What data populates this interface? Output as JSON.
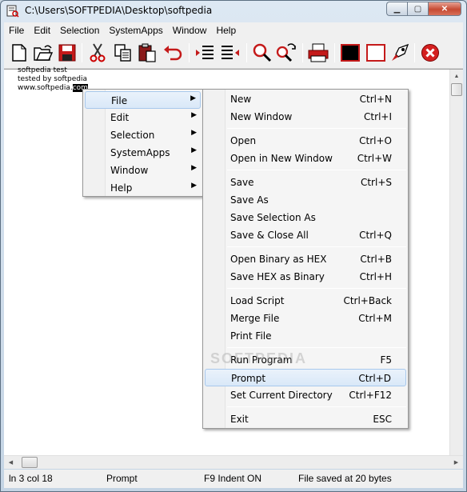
{
  "window": {
    "title": "C:\\Users\\SOFTPEDIA\\Desktop\\softpedia"
  },
  "caption": {
    "minimize": "▁",
    "maximize": "▢",
    "close": "✕"
  },
  "menubar": {
    "items": [
      "File",
      "Edit",
      "Selection",
      "SystemApps",
      "Window",
      "Help"
    ]
  },
  "toolbar": {
    "icons": [
      "new-document-icon",
      "open-folder-icon",
      "save-disk-icon",
      "cut-scissors-icon",
      "copy-icon",
      "paste-icon",
      "undo-icon",
      "indent-icon",
      "outdent-icon",
      "find-icon",
      "replace-icon",
      "print-icon",
      "black-background-icon",
      "white-background-icon",
      "run-rocket-icon",
      "exit-icon"
    ]
  },
  "editor": {
    "lines": [
      "softpedia test",
      "tested by softpedia"
    ],
    "line3_prefix": "www.softpedia.",
    "line3_selected": "com"
  },
  "context_menu": {
    "items": [
      "File",
      "Edit",
      "Selection",
      "SystemApps",
      "Window",
      "Help"
    ],
    "highlighted": "File"
  },
  "file_submenu": {
    "groups": [
      [
        {
          "label": "New",
          "shortcut": "Ctrl+N"
        },
        {
          "label": "New Window",
          "shortcut": "Ctrl+I"
        }
      ],
      [
        {
          "label": "Open",
          "shortcut": "Ctrl+O"
        },
        {
          "label": "Open in New Window",
          "shortcut": "Ctrl+W"
        }
      ],
      [
        {
          "label": "Save",
          "shortcut": "Ctrl+S"
        },
        {
          "label": "Save As",
          "shortcut": ""
        },
        {
          "label": "Save Selection As",
          "shortcut": ""
        },
        {
          "label": "Save & Close All",
          "shortcut": "Ctrl+Q"
        }
      ],
      [
        {
          "label": "Open Binary as HEX",
          "shortcut": "Ctrl+B"
        },
        {
          "label": "Save HEX as Binary",
          "shortcut": "Ctrl+H"
        }
      ],
      [
        {
          "label": "Load Script",
          "shortcut": "Ctrl+Back"
        },
        {
          "label": "Merge File",
          "shortcut": "Ctrl+M"
        },
        {
          "label": "Print File",
          "shortcut": ""
        }
      ],
      [
        {
          "label": "Run Program",
          "shortcut": "F5"
        },
        {
          "label": "Prompt",
          "shortcut": "Ctrl+D"
        },
        {
          "label": "Set Current Directory",
          "shortcut": "Ctrl+F12"
        }
      ],
      [
        {
          "label": "Exit",
          "shortcut": "ESC"
        }
      ]
    ],
    "highlighted": "Prompt"
  },
  "statusbar": {
    "position": "ln 3 col 18",
    "mode": "Prompt",
    "indent": "F9 Indent ON",
    "file_saved": "File saved at  20 bytes"
  },
  "watermark": "SOFTPEDIA"
}
